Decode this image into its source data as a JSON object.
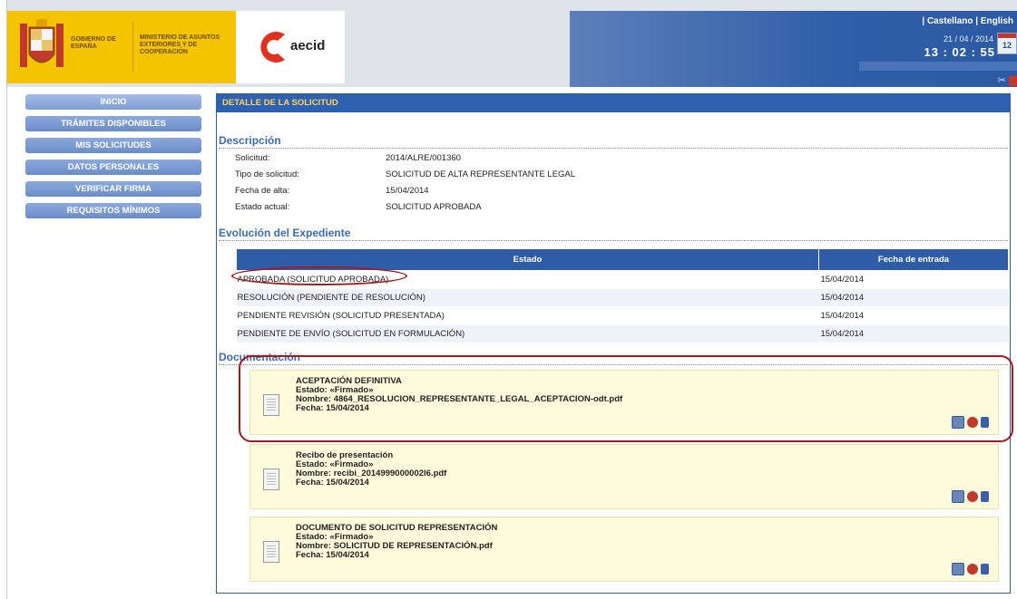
{
  "header": {
    "gov_text": "GOBIERNO DE ESPAÑA",
    "ministry_text": "MINISTERIO DE ASUNTOS EXTERIORES Y DE COOPERACIÓN",
    "aecid_text": "aecid",
    "lang_prefix": "| ",
    "lang_es": "Castellano",
    "lang_sep": " | ",
    "lang_en": "English",
    "date": "21 / 04 / 2014",
    "time": "13 : 02 : 55",
    "calendar_day": "12"
  },
  "menu": {
    "items": [
      {
        "label": "INICIO"
      },
      {
        "label": "TRÁMITES DISPONIBLES"
      },
      {
        "label": "MIS SOLICITUDES"
      },
      {
        "label": "DATOS PERSONALES"
      },
      {
        "label": "VERIFICAR FIRMA"
      },
      {
        "label": "REQUISITOS MÍNIMOS"
      }
    ]
  },
  "panel": {
    "title": "DETALLE DE LA SOLICITUD",
    "descripcion": {
      "title": "Descripción",
      "rows": [
        {
          "k": "Solicitud:",
          "v": "2014/ALRE/001360"
        },
        {
          "k": "Tipo de solicitud:",
          "v": "SOLICITUD DE ALTA REPRESENTANTE LEGAL"
        },
        {
          "k": "Fecha de alta:",
          "v": "15/04/2014"
        },
        {
          "k": "Estado actual:",
          "v": "SOLICITUD APROBADA"
        }
      ]
    },
    "evolucion": {
      "title": "Evolución del Expediente",
      "col_estado": "Estado",
      "col_fecha": "Fecha de entrada",
      "rows": [
        {
          "estado": "APROBADA (SOLICITUD APROBADA)",
          "fecha": "15/04/2014"
        },
        {
          "estado": "RESOLUCIÓN (PENDIENTE DE RESOLUCIÓN)",
          "fecha": "15/04/2014"
        },
        {
          "estado": "PENDIENTE REVISIÓN (SOLICITUD PRESENTADA)",
          "fecha": "15/04/2014"
        },
        {
          "estado": "PENDIENTE DE ENVÍO (SOLICITUD EN FORMULACIÓN)",
          "fecha": "15/04/2014"
        }
      ]
    },
    "documentacion": {
      "title": "Documentación",
      "docs": [
        {
          "name": "ACEPTACIÓN DEFINITIVA",
          "estado": "Estado: «Firmado»",
          "nombre": "Nombre: 4864_RESOLUCION_REPRESENTANTE_LEGAL_ACEPTACION-odt.pdf",
          "fecha": "Fecha: 15/04/2014"
        },
        {
          "name": "Recibo de presentación",
          "estado": "Estado: «Firmado»",
          "nombre": "Nombre: recibi_2014999000002l6.pdf",
          "fecha": "Fecha: 15/04/2014"
        },
        {
          "name": "DOCUMENTO DE SOLICITUD REPRESENTACIÓN",
          "estado": "Estado: «Firmado»",
          "nombre": "Nombre: SOLICITUD DE REPRESENTACIÓN.pdf",
          "fecha": "Fecha: 15/04/2014"
        }
      ]
    }
  },
  "colors": {
    "header_blue": "#2e62b0",
    "menu_blue": "#7d9dd4",
    "doc_bg": "#fdfbdc",
    "mark_red": "#a11b1b",
    "title_yellow": "#ffd35c"
  }
}
